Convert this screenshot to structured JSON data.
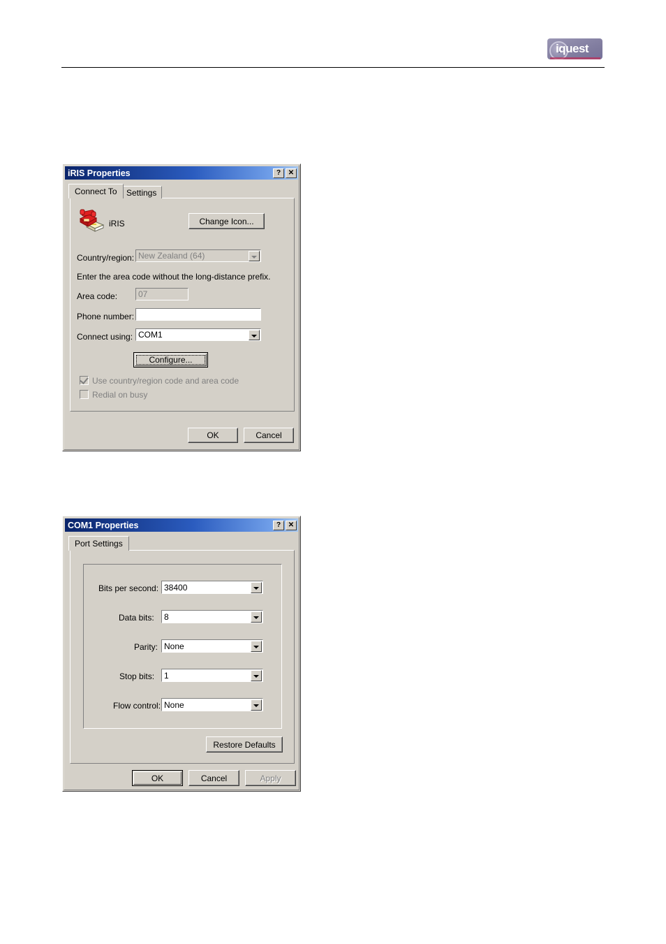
{
  "page": {
    "logo_text": "iquest",
    "logo_name": "iquest-logo"
  },
  "dialog1": {
    "title": "iRIS Properties",
    "help_button": "?",
    "close_button": "✕",
    "tabs": [
      {
        "label": "Connect To",
        "active": true
      },
      {
        "label": "Settings",
        "active": false
      }
    ],
    "connection_name": "iRIS",
    "change_icon_button": "Change Icon...",
    "fields": {
      "country_label": "Country/region:",
      "country_value": "New Zealand (64)",
      "country_disabled": true,
      "hint": "Enter the area code without the long-distance prefix.",
      "area_code_label": "Area code:",
      "area_code_value": "07",
      "area_code_disabled": true,
      "phone_number_label": "Phone number:",
      "phone_number_value": "",
      "connect_using_label": "Connect using:",
      "connect_using_value": "COM1"
    },
    "configure_button": "Configure...",
    "checkboxes": [
      {
        "label": "Use country/region code and area code",
        "checked": true,
        "disabled": true
      },
      {
        "label": "Redial on busy",
        "checked": false,
        "disabled": true
      }
    ],
    "ok_button": "OK",
    "cancel_button": "Cancel"
  },
  "dialog2": {
    "title": "COM1 Properties",
    "help_button": "?",
    "close_button": "✕",
    "tabs": [
      {
        "label": "Port Settings",
        "active": true
      }
    ],
    "settings": [
      {
        "label": "Bits per second:",
        "value": "38400"
      },
      {
        "label": "Data bits:",
        "value": "8"
      },
      {
        "label": "Parity:",
        "value": "None"
      },
      {
        "label": "Stop bits:",
        "value": "1"
      },
      {
        "label": "Flow control:",
        "value": "None"
      }
    ],
    "restore_defaults_button": "Restore Defaults",
    "ok_button": "OK",
    "cancel_button": "Cancel",
    "apply_button": "Apply",
    "apply_disabled": true
  }
}
